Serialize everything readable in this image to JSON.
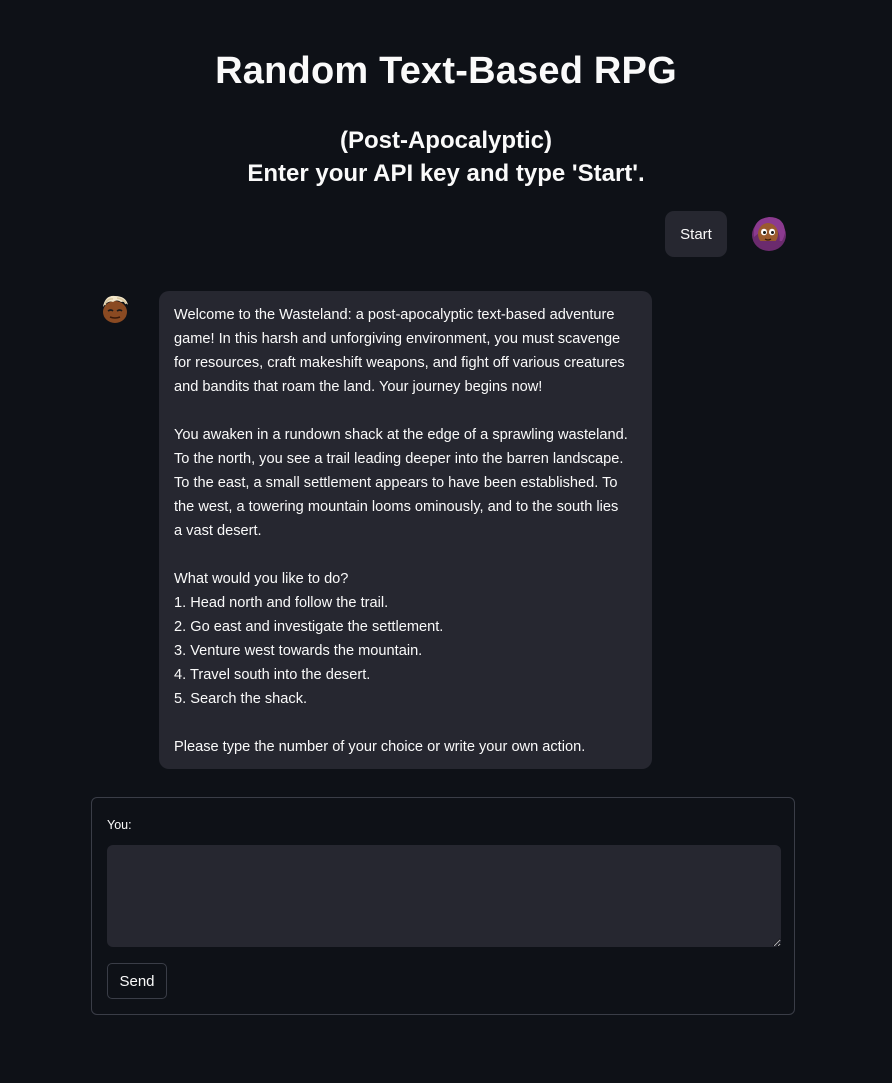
{
  "header": {
    "title": "Random Text-Based RPG",
    "subtitle_line1": "(Post-Apocalyptic)",
    "subtitle_line2": "Enter your API key and type 'Start'."
  },
  "chat": {
    "user_message": "Start",
    "bot_message": {
      "intro_lines": [
        "Welcome to the Wasteland: a post-apocalyptic text-based adventure",
        "game! In this harsh and unforgiving environment, you must scavenge",
        "for resources, craft makeshift weapons, and fight off various creatures",
        "and bandits that roam the land. Your journey begins now!"
      ],
      "scene_lines": [
        "You awaken in a rundown shack at the edge of a sprawling wasteland.",
        "To the north, you see a trail leading deeper into the barren landscape.",
        "To the east, a small settlement appears to have been established. To",
        "the west, a towering mountain looms ominously, and to the south lies",
        "a vast desert."
      ],
      "choice_lines": [
        "What would you like to do?",
        "1. Head north and follow the trail.",
        "2. Go east and investigate the settlement.",
        "3. Venture west towards the mountain.",
        "4. Travel south into the desert.",
        "5. Search the shack."
      ],
      "outro_lines": [
        "Please type the number of your choice or write your own action."
      ]
    }
  },
  "form": {
    "label": "You:",
    "input_value": "",
    "send_label": "Send"
  },
  "colors": {
    "background": "#0e1117",
    "bubble": "#262730",
    "text": "#fafafa",
    "border": "#3a3d47"
  },
  "icons": {
    "user_avatar": "user-avatar-icon",
    "bot_avatar": "bot-avatar-icon"
  }
}
